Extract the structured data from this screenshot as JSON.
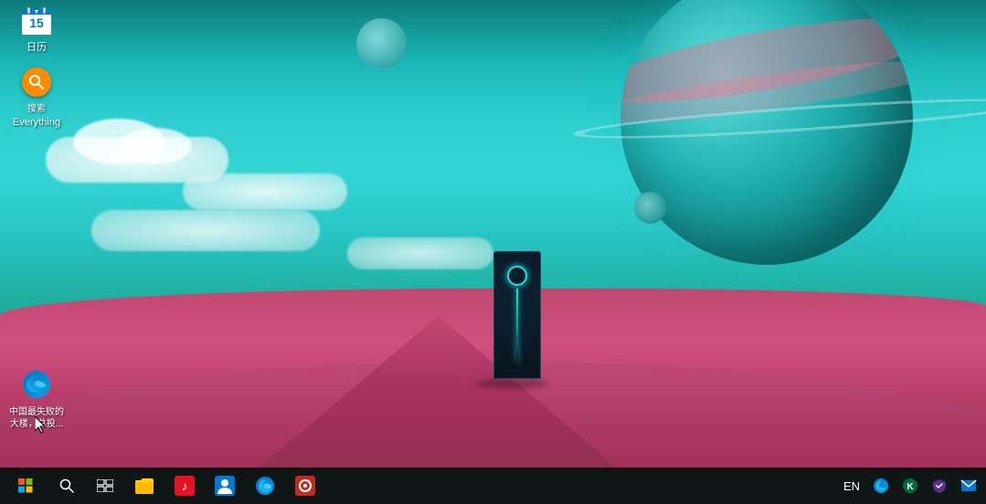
{
  "desktop": {
    "wallpaper_desc": "Sci-fi landscape with teal sky, pink/red terrain, large teal planet, monolith tower"
  },
  "icons": {
    "calendar": {
      "label": "日历",
      "position": "top-left"
    },
    "everything": {
      "label": "Everything",
      "sublabel": "搜索",
      "position": "top-left-below-calendar"
    },
    "edge_desktop": {
      "label": "中国最失败的大楼，总投...",
      "position": "bottom-left"
    }
  },
  "taskbar": {
    "start_label": "Start",
    "search_label": "Search",
    "taskview_label": "Task View",
    "apps": [
      {
        "name": "file-explorer",
        "label": "File Explorer"
      },
      {
        "name": "music",
        "label": "Music"
      },
      {
        "name": "people",
        "label": "People"
      },
      {
        "name": "edge-browser",
        "label": "Microsoft Edge"
      },
      {
        "name": "canteen",
        "label": "App"
      },
      {
        "name": "edge2",
        "label": "Microsoft Edge"
      },
      {
        "name": "kaspersky",
        "label": "Kaspersky"
      },
      {
        "name": "unknown",
        "label": "App"
      }
    ],
    "tray": {
      "language": "EN",
      "clock_time": "",
      "clock_date": ""
    }
  },
  "cursor": {
    "visible": true
  }
}
